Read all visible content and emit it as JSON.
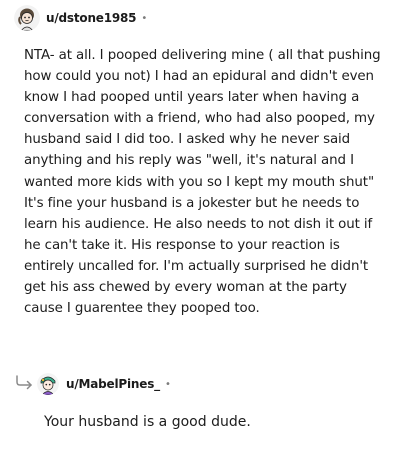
{
  "comment": {
    "author": "u/dstone1985",
    "separator": "•",
    "avatar": "user-avatar-icon",
    "body": "NTA- at all. I pooped delivering mine ( all that pushing how could you not) I had an epidural and didn't even know I had pooped until years later when having a conversation with a friend, who had also pooped, my husband said I did too. I asked why he never said anything and his reply was \"well, it's natural and I wanted more kids with you so I kept my mouth shut\" It's fine your husband is a jokester but he needs to learn his audience. He also needs to not dish it out if he can't take it. His response to your reaction is entirely uncalled for. I'm actually surprised he didn't get his ass chewed by every woman at the party cause I guarentee they pooped too."
  },
  "reply": {
    "author": "u/MabelPines_",
    "separator": "•",
    "avatar": "user-avatar-icon",
    "reply_icon": "reply-arrow-icon",
    "body": "Your husband is a good dude."
  }
}
